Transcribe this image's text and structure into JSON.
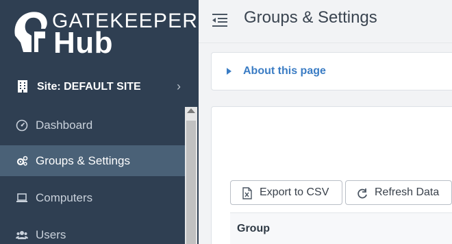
{
  "brand": {
    "name": "GATEKEEPER",
    "sub": "Hub"
  },
  "site": {
    "label": "Site: DEFAULT SITE"
  },
  "sidebar": {
    "items": [
      {
        "label": "Dashboard",
        "icon": "dashboard-icon",
        "active": false
      },
      {
        "label": "Groups & Settings",
        "icon": "cogs-icon",
        "active": true
      },
      {
        "label": "Computers",
        "icon": "laptop-icon",
        "active": false
      },
      {
        "label": "Users",
        "icon": "users-icon",
        "active": false
      }
    ]
  },
  "header": {
    "title": "Groups & Settings"
  },
  "about": {
    "label": "About this page"
  },
  "toolbar": {
    "export_label": "Export to CSV",
    "refresh_label": "Refresh Data"
  },
  "table": {
    "columns": [
      "Group"
    ]
  },
  "colors": {
    "sidebar_bg": "#2f3f52",
    "active_bg": "#4a6177",
    "link_blue": "#3a7cc4"
  }
}
